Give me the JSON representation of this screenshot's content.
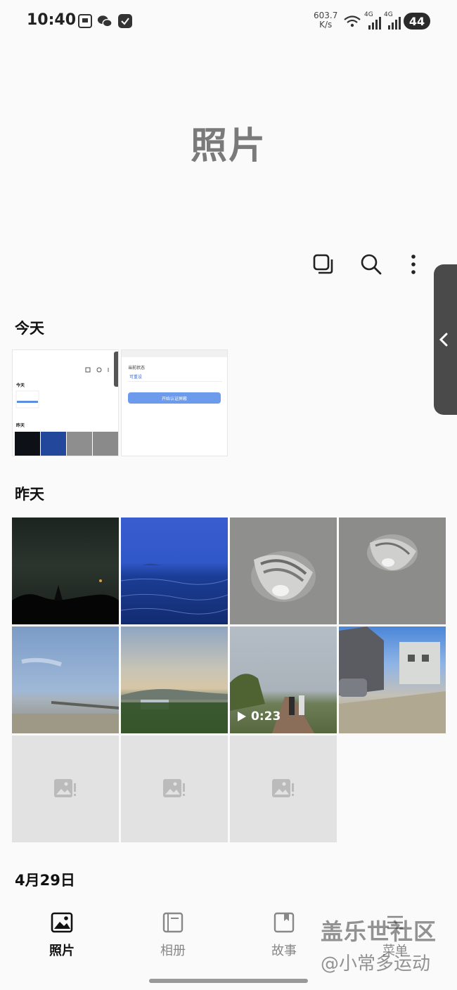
{
  "status_bar": {
    "time": "10:40",
    "speed_value": "603.7",
    "speed_unit": "K/s",
    "net1": "4G",
    "net2": "4G",
    "battery": "44"
  },
  "page": {
    "title": "照片"
  },
  "toolbar": {
    "select_icon": "select-multiple-icon",
    "search_icon": "search-icon",
    "more_icon": "more-vertical-icon"
  },
  "sections": {
    "today": "今天",
    "yesterday": "昨天",
    "apr29": "4月29日"
  },
  "screenshot_thumb": {
    "today": "今天",
    "yesterday": "昨天",
    "field_label": "当前状态",
    "field_value": "可重设",
    "button": "开始认证屏蔽"
  },
  "video": {
    "duration": "0:23"
  },
  "bottom_nav": {
    "items": [
      {
        "label": "照片",
        "icon": "photo-icon",
        "active": true
      },
      {
        "label": "相册",
        "icon": "album-icon",
        "active": false
      },
      {
        "label": "故事",
        "icon": "story-icon",
        "active": false
      },
      {
        "label": "菜单",
        "icon": "menu-icon",
        "active": false
      }
    ]
  },
  "watermark": {
    "line1": "盖乐世社区",
    "line2": "@小常多运动"
  }
}
